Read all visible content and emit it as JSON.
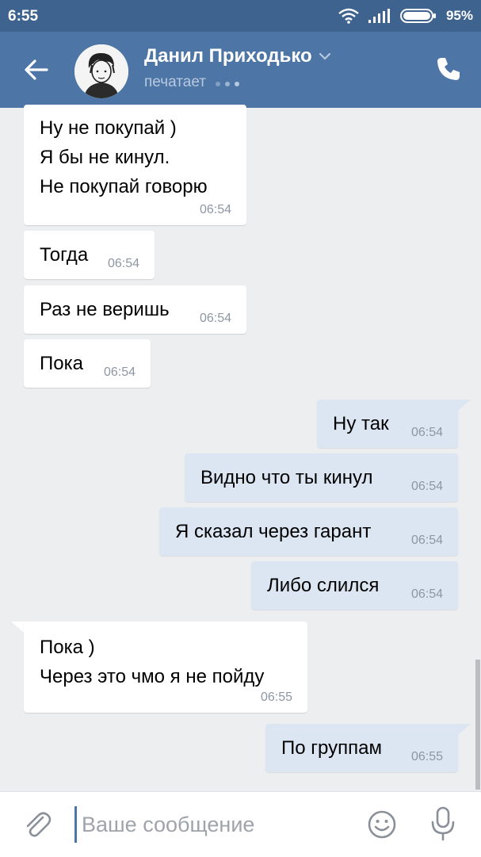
{
  "status_bar": {
    "time": "6:55",
    "battery": "95%",
    "icons": [
      "wifi-icon",
      "signal-icon",
      "battery-icon"
    ]
  },
  "header": {
    "contact_name": "Данил Приходько",
    "status": "печатает",
    "icons": [
      "back-arrow-icon",
      "chevron-down-icon",
      "phone-icon"
    ]
  },
  "messages": [
    {
      "dir": "in",
      "lines": [
        "Ну не покупай )",
        "Я бы не кинул.",
        "Не покупай говорю"
      ],
      "time": "06:54"
    },
    {
      "dir": "in",
      "text": "Тогда",
      "time": "06:54"
    },
    {
      "dir": "in",
      "text": "Раз не веришь",
      "time": "06:54"
    },
    {
      "dir": "in",
      "text": "Пока",
      "time": "06:54"
    },
    {
      "dir": "out",
      "text": "Ну так",
      "time": "06:54"
    },
    {
      "dir": "out",
      "text": "Видно что ты кинул",
      "time": "06:54"
    },
    {
      "dir": "out",
      "text": "Я сказал через гарант",
      "time": "06:54"
    },
    {
      "dir": "out",
      "text": "Либо слился",
      "time": "06:54"
    },
    {
      "dir": "in",
      "lines": [
        "Пока )",
        "Через это чмо я не пойду"
      ],
      "time": "06:55"
    },
    {
      "dir": "out",
      "text": "По группам",
      "time": "06:55"
    }
  ],
  "composer": {
    "placeholder": "Ваше сообщение",
    "value": "",
    "icons": [
      "paperclip-icon",
      "emoji-icon",
      "microphone-icon"
    ]
  },
  "colors": {
    "header": "#4d76a6",
    "status_bar": "#3f638f",
    "background": "#edeef0",
    "outgoing_bubble": "#dce6f3",
    "incoming_bubble": "#ffffff"
  }
}
